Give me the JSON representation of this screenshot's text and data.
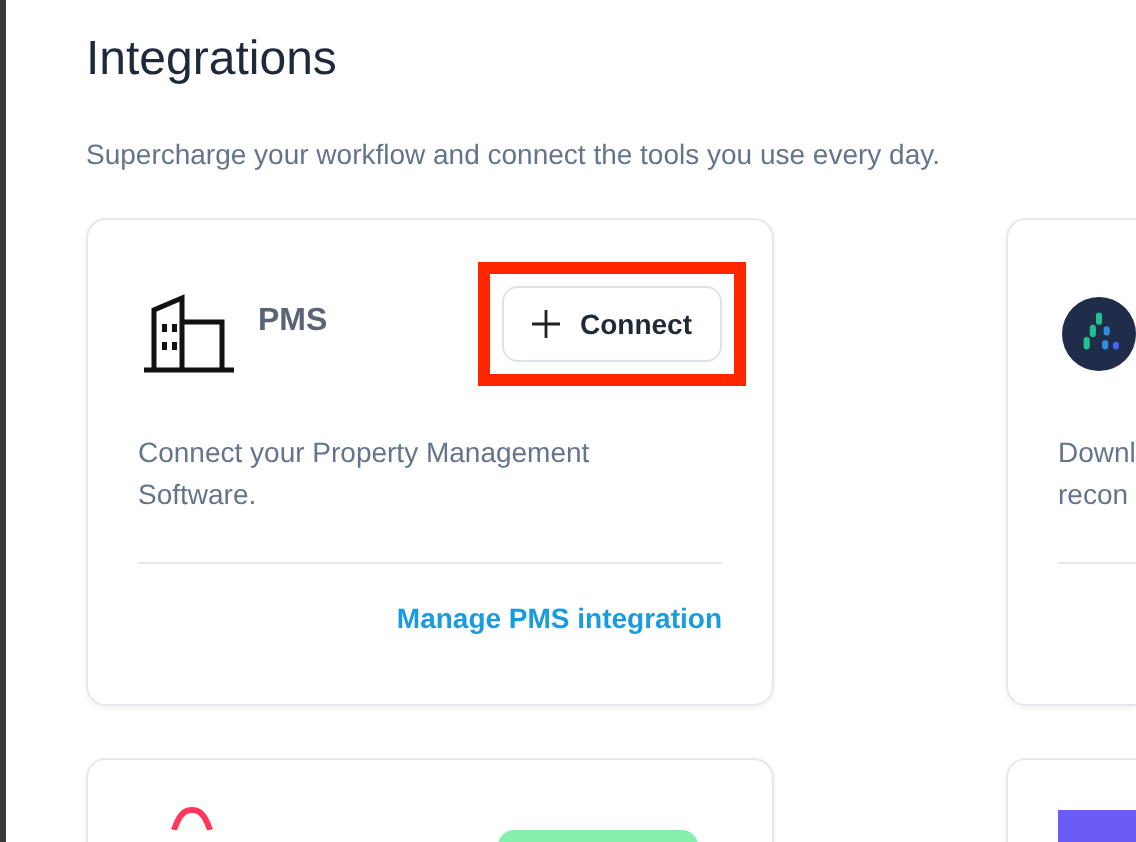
{
  "page": {
    "title": "Integrations",
    "subtitle": "Supercharge your workflow and connect the tools you use every day."
  },
  "integrations": [
    {
      "kind": "building",
      "name": "PMS",
      "button": {
        "label": "Connect",
        "highlighted": true
      },
      "description": "Connect your Property Management Software.",
      "link": "Manage PMS integration"
    },
    {
      "kind": "logo",
      "description": "Downl recon"
    },
    {
      "kind": "arc"
    },
    {
      "kind": "square"
    }
  ]
}
